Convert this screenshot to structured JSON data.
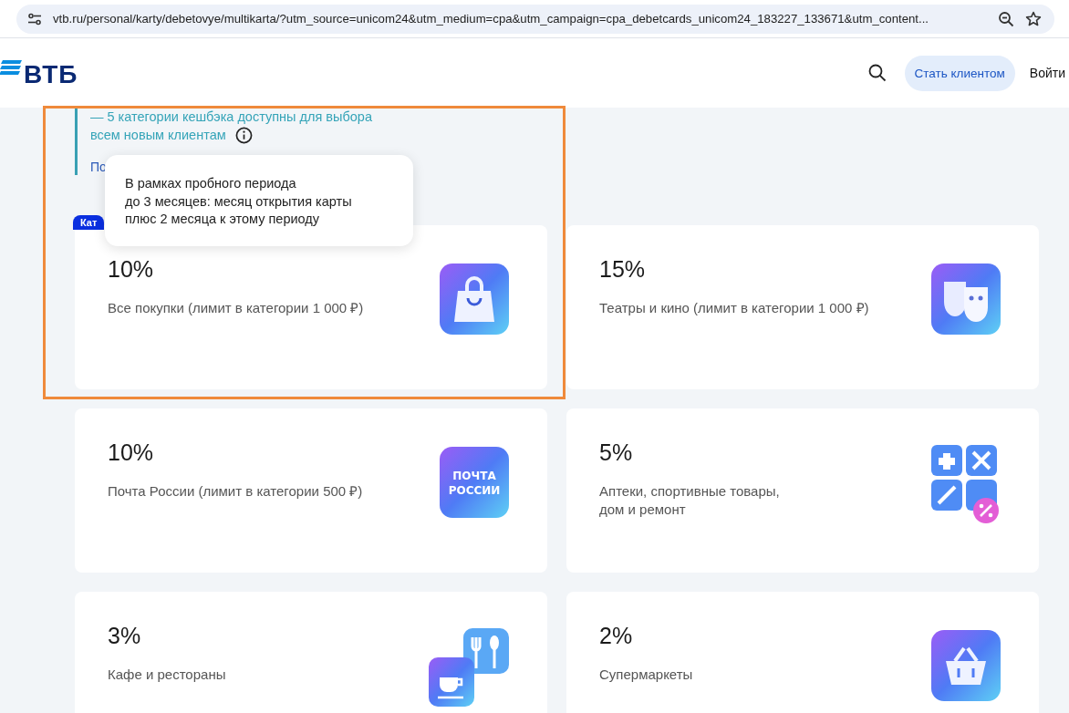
{
  "address_bar": {
    "url": "vtb.ru/personal/karty/debetovye/multikarta/?utm_source=unicom24&utm_medium=cpa&utm_campaign=cpa_debetcards_unicom24_183227_133671&utm_content..."
  },
  "header": {
    "logo": "ВТБ",
    "cta": "Стать клиентом",
    "login": "Войти"
  },
  "info": {
    "lines": [
      "— 5 категории кешбэка доступны для выбора",
      "всем новым клиентам"
    ],
    "link_fragment": "По",
    "badge_fragment": "Кат"
  },
  "tooltip": {
    "text": "В рамках пробного периода\nдо 3 месяцев: месяц открытия карты\nплюс 2 месяца к этому периоду"
  },
  "highlight": {
    "shown": true
  },
  "cards": [
    {
      "percent": "10%",
      "description": "Все покупки (лимит в категории 1 000 ₽)",
      "kind": "bag"
    },
    {
      "percent": "15%",
      "description": "Театры и кино (лимит в категории 1 000 ₽)",
      "kind": "masks"
    },
    {
      "percent": "10%",
      "description": "Почта России (лимит в категории 500 ₽)",
      "kind": "post",
      "icon_text": "ПОЧТА РОССИИ"
    },
    {
      "percent": "5%",
      "description": "Аптеки, спортивные товары,\nдом и ремонт",
      "kind": "tiles"
    },
    {
      "percent": "3%",
      "description": "Кафе и рестораны",
      "kind": "cafe"
    },
    {
      "percent": "2%",
      "description": "Супермаркеты",
      "kind": "basket"
    }
  ]
}
